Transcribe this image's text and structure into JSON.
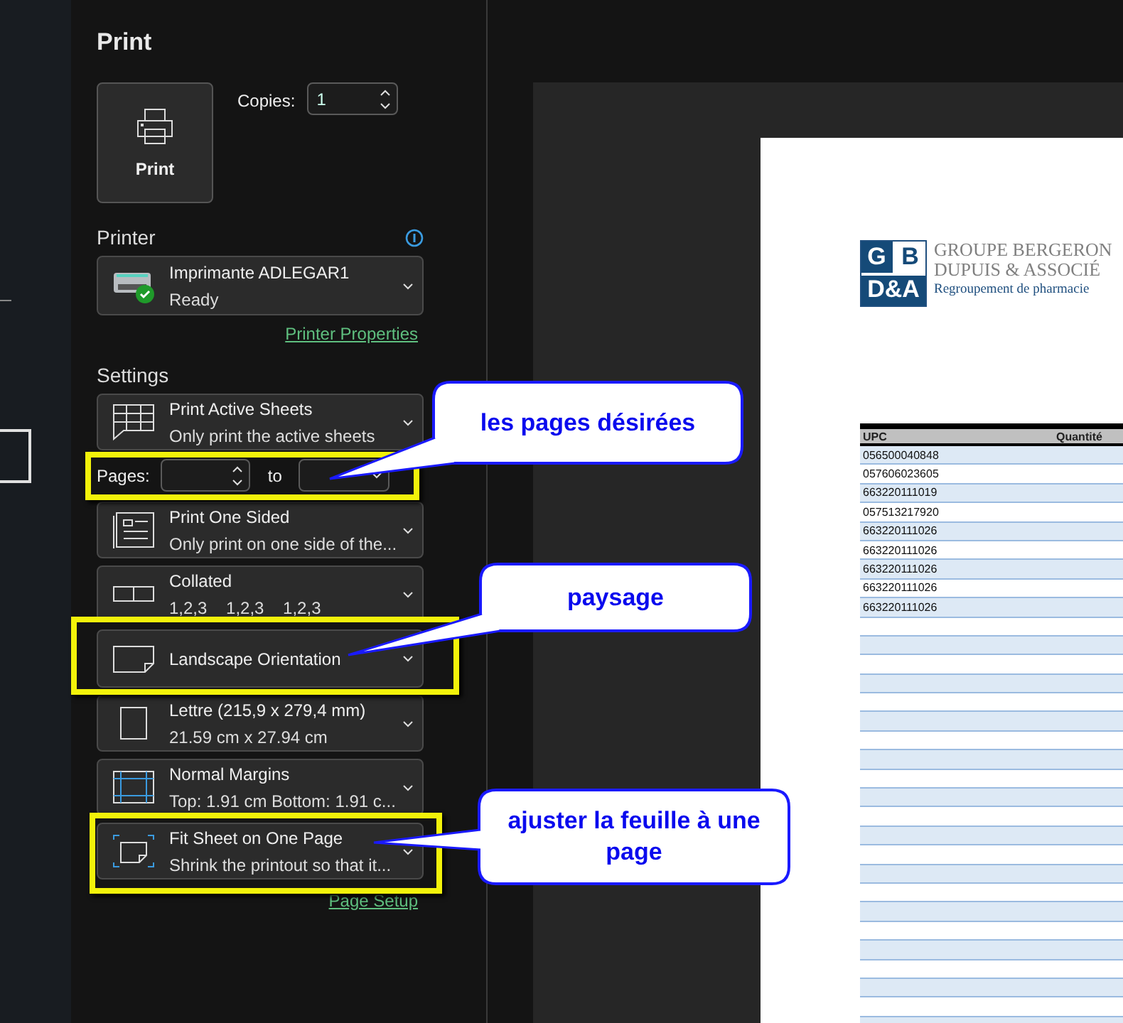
{
  "title": "Print",
  "print_button": {
    "label": "Print"
  },
  "copies": {
    "label": "Copies:",
    "value": "1"
  },
  "printer": {
    "heading": "Printer",
    "name": "Imprimante ADLEGAR1",
    "status": "Ready",
    "properties_link": "Printer Properties"
  },
  "settings": {
    "heading": "Settings",
    "items": [
      {
        "kind": "sheets",
        "title": "Print Active Sheets",
        "subtitle": "Only print the active sheets"
      },
      {
        "kind": "pages",
        "label": "Pages:",
        "to": "to"
      },
      {
        "kind": "sides",
        "title": "Print One Sided",
        "subtitle": "Only print on one side of the..."
      },
      {
        "kind": "collate",
        "title": "Collated",
        "subtitle": "1,2,3    1,2,3    1,2,3"
      },
      {
        "kind": "orientation",
        "title": "Landscape Orientation"
      },
      {
        "kind": "paper",
        "title": "Lettre (215,9 x 279,4 mm)",
        "subtitle": "21.59 cm x 27.94 cm"
      },
      {
        "kind": "margins",
        "title": "Normal Margins",
        "subtitle": "Top: 1.91 cm Bottom: 1.91 c..."
      },
      {
        "kind": "scaling",
        "title": "Fit Sheet on One Page",
        "subtitle": "Shrink the printout so that it..."
      }
    ],
    "page_setup_link": "Page Setup"
  },
  "preview": {
    "logo": {
      "letters": [
        "G",
        "B",
        "D&A"
      ],
      "lines": [
        "GROUPE BERGERON",
        "DUPUIS & ASSOCIÉ",
        "Regroupement de pharmacie"
      ]
    },
    "table": {
      "columns": [
        "UPC",
        "Quantité"
      ],
      "rows": [
        "056500040848",
        "057606023605",
        "663220111019",
        "057513217920",
        "663220111026",
        "663220111026",
        "663220111026",
        "663220111026",
        "663220111026"
      ]
    }
  },
  "callouts": [
    "les pages désirées",
    "paysage",
    "ajuster la feuille à une page"
  ]
}
